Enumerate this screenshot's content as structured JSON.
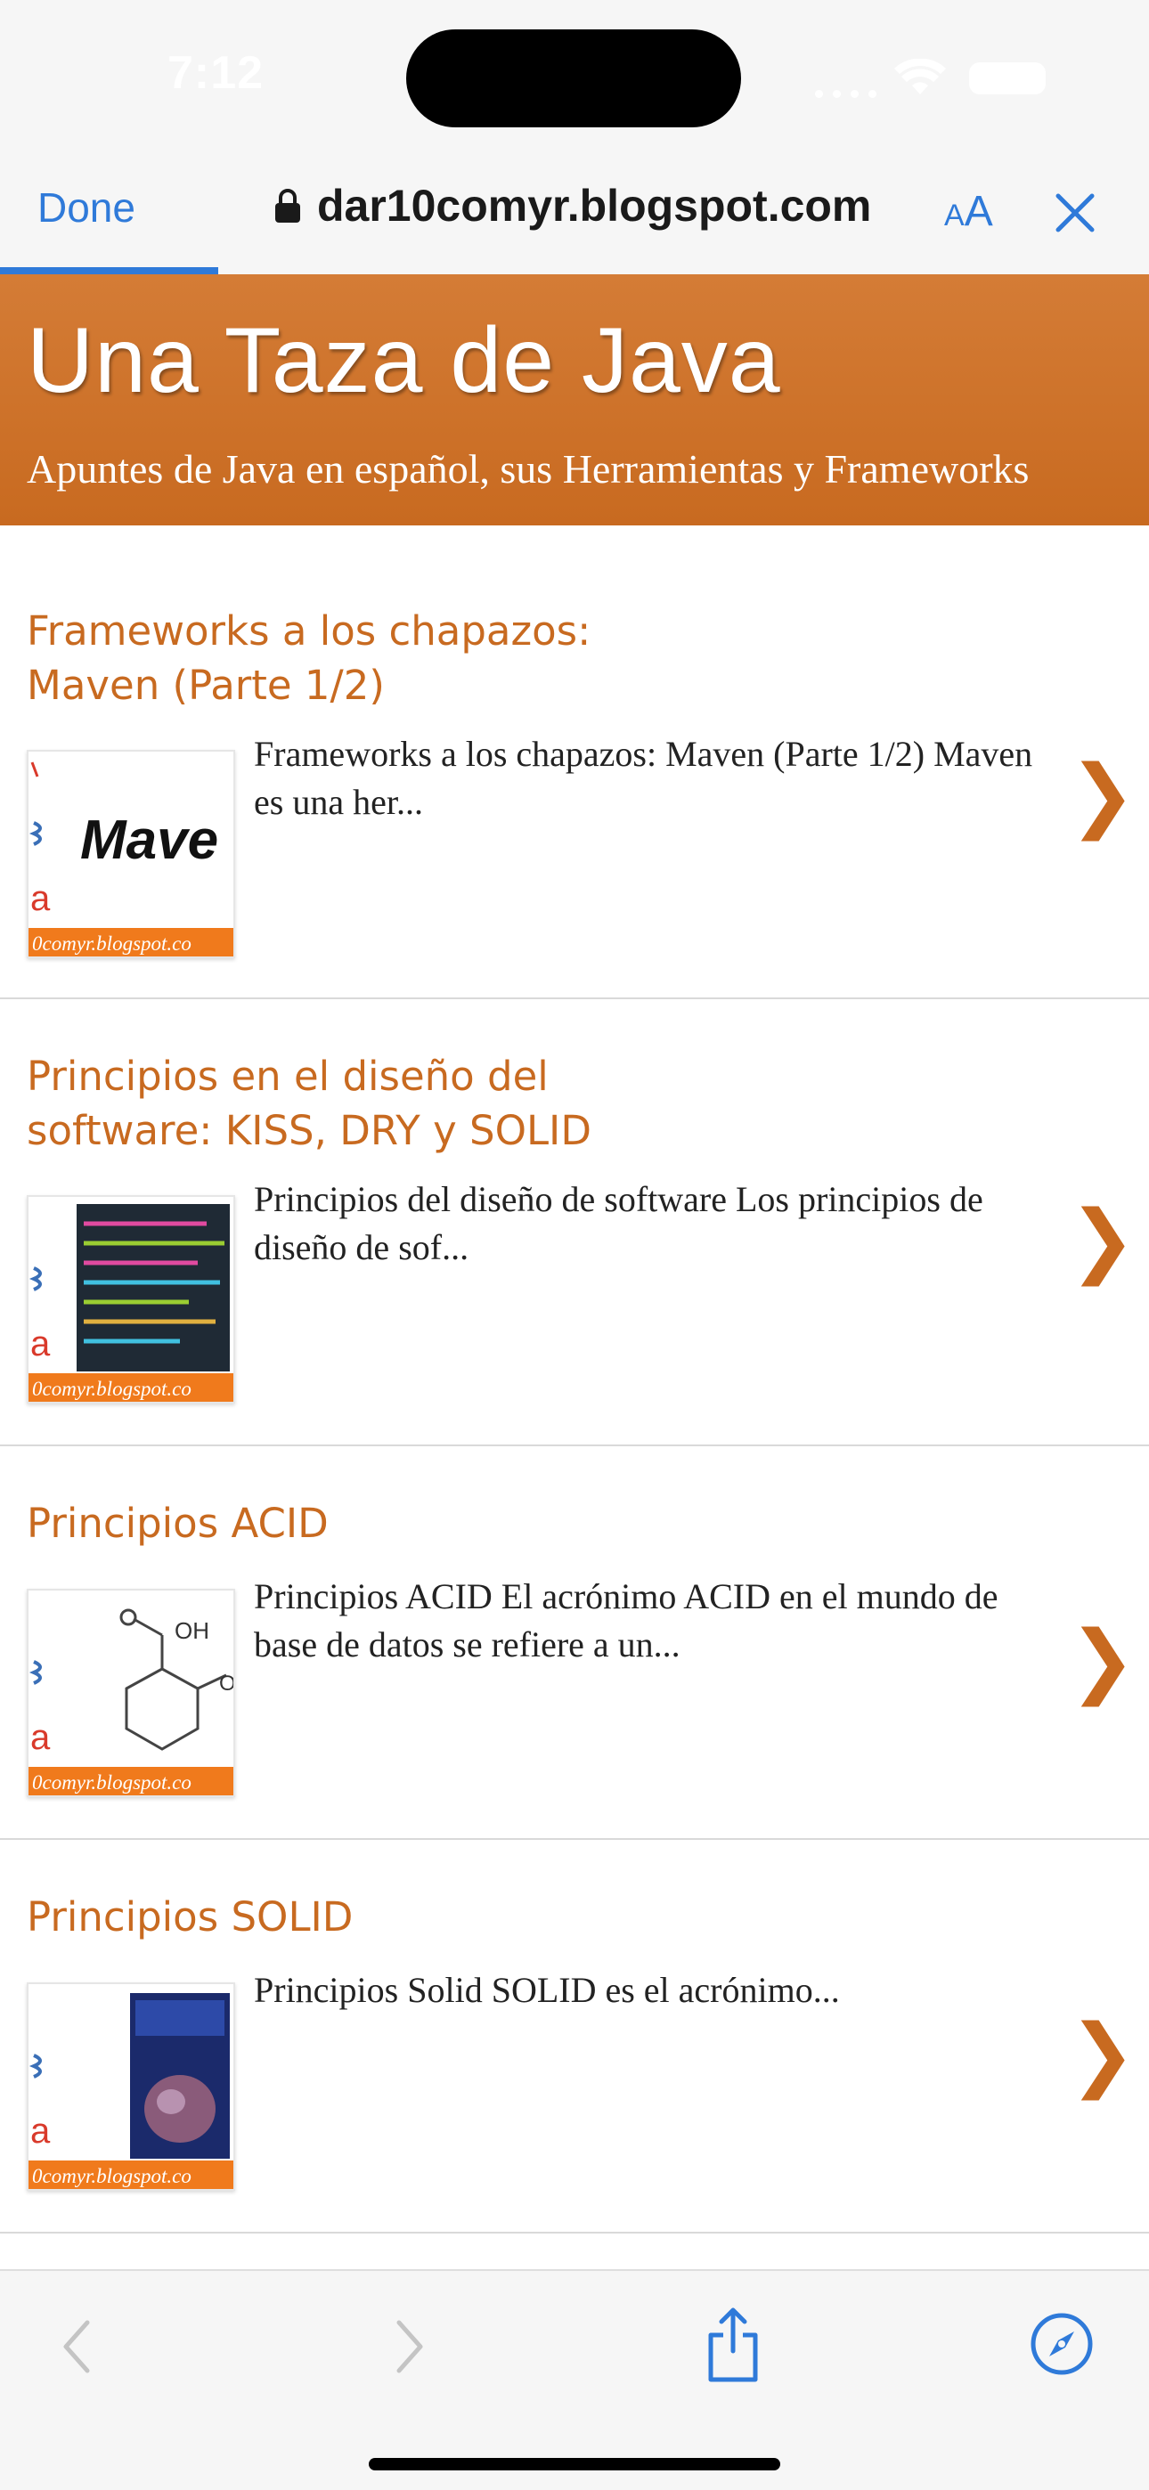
{
  "status_bar": {
    "time": "7:12"
  },
  "toolbar": {
    "done_label": "Done",
    "url": "dar10comyr.blogspot.com",
    "text_size_label_small": "A",
    "text_size_label_big": "A",
    "load_progress_pct": 19
  },
  "blog": {
    "title": "Una Taza de Java",
    "description": "Apuntes de Java en español, sus Herramientas y Frameworks"
  },
  "posts": [
    {
      "title_line1": "Frameworks a los chapazos:",
      "title_line2": "Maven (Parte 1/2)",
      "snippet": "Frameworks a los chapazos: Maven (Parte 1/2) Maven es una her...",
      "thumb_text": "Mave",
      "thumb_footer": "0comyr.blogspot.co"
    },
    {
      "title_line1": "Principios en el diseño del",
      "title_line2": "software: KISS, DRY y SOLID",
      "snippet": "Principios del diseño de software Los principios de diseño de sof...",
      "thumb_footer": "0comyr.blogspot.co"
    },
    {
      "title_line1": "Principios ACID",
      "title_line2": "",
      "snippet": "Principios ACID El acrónimo ACID en el mundo de base de datos se refiere a un...",
      "thumb_text": "OH",
      "thumb_footer": "0comyr.blogspot.co"
    },
    {
      "title_line1": "Principios SOLID",
      "title_line2": "",
      "snippet": "Principios Solid SOLID es el acrónimo...",
      "thumb_footer": "0comyr.blogspot.co"
    }
  ],
  "chevron": "❯",
  "colors": {
    "accent": "#c86a20",
    "link_blue": "#2f7ad9",
    "toolbar_bg": "#f6f6f6"
  }
}
